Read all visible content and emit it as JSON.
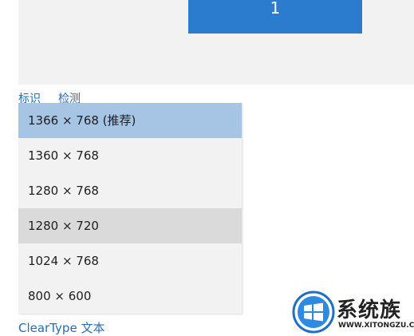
{
  "display": {
    "monitor_number": "1",
    "links": {
      "identify": "标识",
      "detect": "检测"
    },
    "resolutions": [
      {
        "label": "1366 × 768 (推荐)",
        "state": "selected"
      },
      {
        "label": "1360 × 768",
        "state": "normal"
      },
      {
        "label": "1280 × 768",
        "state": "normal"
      },
      {
        "label": "1280 × 720",
        "state": "hovered"
      },
      {
        "label": "1024 × 768",
        "state": "normal"
      },
      {
        "label": "800 × 600",
        "state": "normal"
      }
    ],
    "cleartype_link": "ClearType 文本"
  },
  "watermark": {
    "brand": "系统族",
    "url": "WWW.XITONGZU.COM"
  },
  "colors": {
    "accent": "#2b7bcf",
    "link": "#2a6cb5",
    "selected": "#a6c4e3",
    "hovered": "#dadada",
    "panel": "#f2f2f2"
  }
}
